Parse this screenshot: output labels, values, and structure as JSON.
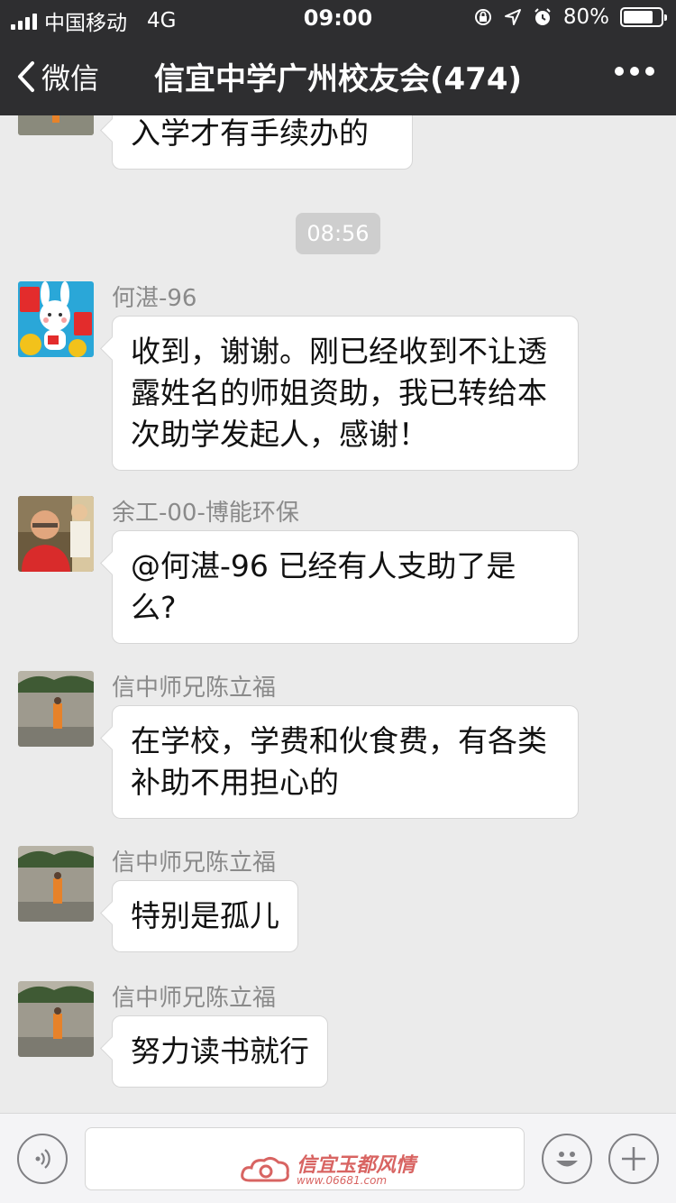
{
  "status_bar": {
    "carrier": "中国移动",
    "network": "4G",
    "time": "09:00",
    "battery": "80%",
    "battery_level": 0.8
  },
  "nav": {
    "back_label": "微信",
    "title": "信宜中学广州校友会(474)"
  },
  "messages": [
    {
      "text": "入学才有手续办的"
    },
    {
      "timestamp": "08:56"
    },
    {
      "sender": "何湛-96",
      "text": "收到，谢谢。刚已经收到不让透露姓名的师姐资助，我已转给本次助学发起人，感谢！"
    },
    {
      "sender": "余工-00-博能环保",
      "text": "@何湛-96 已经有人支助了是么?"
    },
    {
      "sender": "信中师兄陈立福",
      "text": "在学校，学费和伙食费，有各类补助不用担心的"
    },
    {
      "sender": "信中师兄陈立福",
      "text": "特别是孤儿"
    },
    {
      "sender": "信中师兄陈立福",
      "text": "努力读书就行"
    }
  ],
  "input": {
    "watermark_title": "信宜玉都风情",
    "watermark_url": "www.06681.com"
  },
  "colors": {
    "header_bg": "#2e2e30",
    "chat_bg": "#ebebeb",
    "bubble_bg": "#ffffff",
    "watermark": "#d24a47"
  }
}
